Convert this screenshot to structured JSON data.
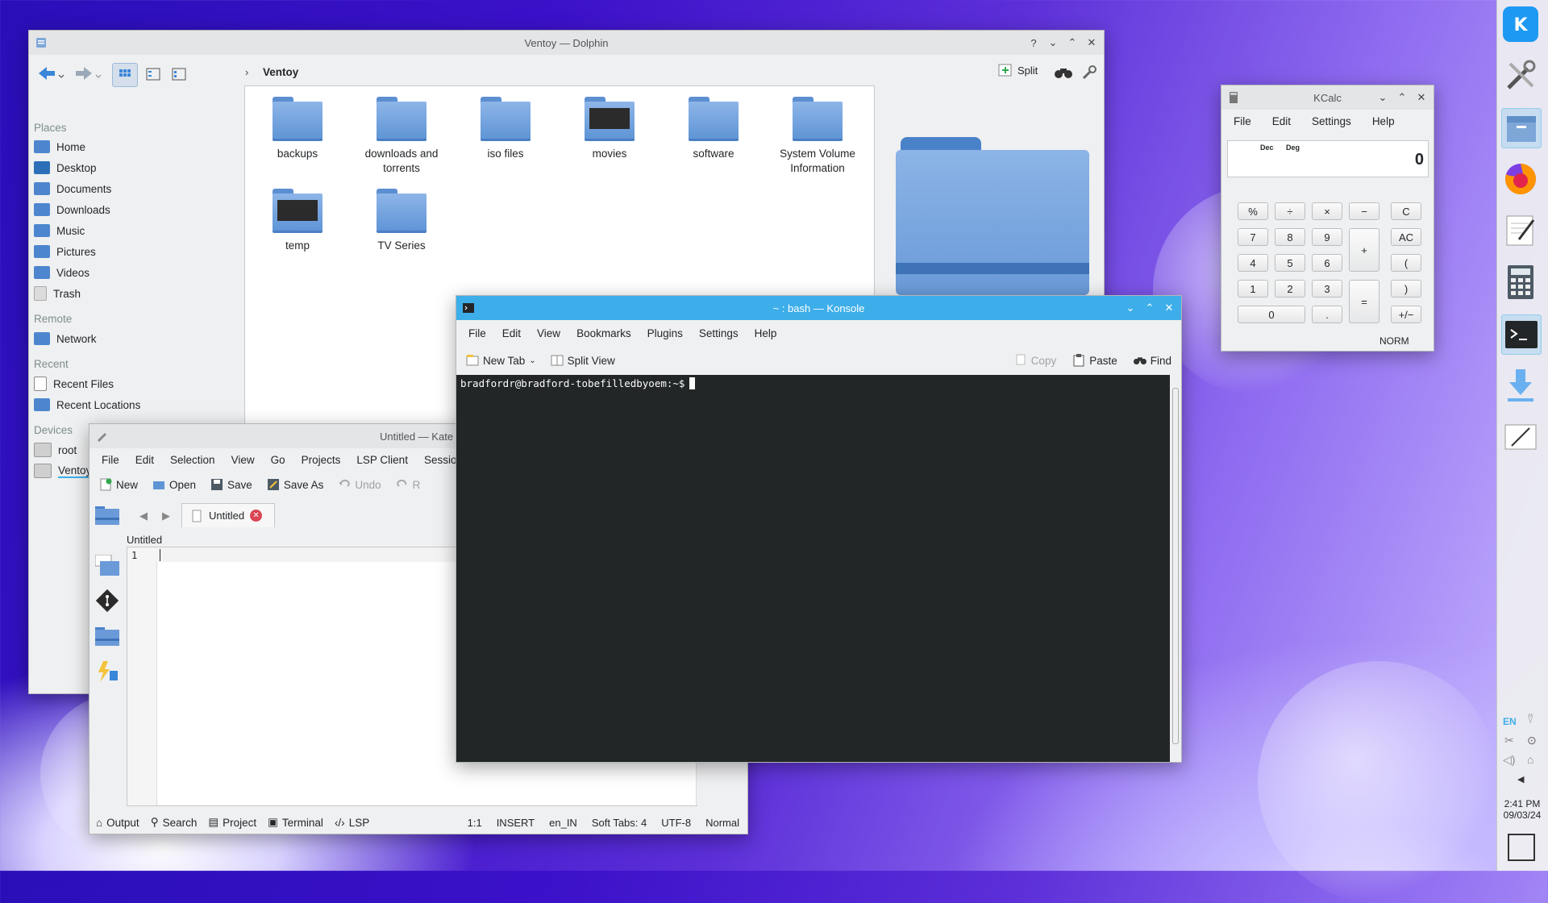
{
  "dolphin": {
    "title": "Ventoy — Dolphin",
    "breadcrumb": "Ventoy",
    "split_label": "Split",
    "places_header": "Places",
    "places": [
      "Home",
      "Desktop",
      "Documents",
      "Downloads",
      "Music",
      "Pictures",
      "Videos",
      "Trash"
    ],
    "remote_header": "Remote",
    "remote": [
      "Network"
    ],
    "recent_header": "Recent",
    "recent": [
      "Recent Files",
      "Recent Locations"
    ],
    "devices_header": "Devices",
    "devices": [
      "root",
      "Ventoy"
    ],
    "folders": [
      {
        "name": "backups",
        "icon": "folder-icon"
      },
      {
        "name": "downloads and",
        "name2": "torrents",
        "icon": "folder-icon"
      },
      {
        "name": "iso files",
        "icon": "folder-icon"
      },
      {
        "name": "movies",
        "icon": "folder-video-icon"
      },
      {
        "name": "software",
        "icon": "folder-icon"
      },
      {
        "name": "System Volume",
        "name2": "Information",
        "icon": "folder-icon"
      },
      {
        "name": "temp",
        "icon": "folder-video-icon"
      },
      {
        "name": "TV Series",
        "icon": "folder-icon"
      }
    ]
  },
  "kate": {
    "title": "Untitled — Kate",
    "menu": [
      "File",
      "Edit",
      "Selection",
      "View",
      "Go",
      "Projects",
      "LSP Client",
      "Session"
    ],
    "toolbar": {
      "new": "New",
      "open": "Open",
      "save": "Save",
      "save_as": "Save As",
      "undo": "Undo",
      "redo": "R"
    },
    "tab": "Untitled",
    "doc_title": "Untitled",
    "line_number": "1",
    "bottom": {
      "output": "Output",
      "search": "Search",
      "project": "Project",
      "terminal": "Terminal",
      "lsp": "LSP"
    },
    "status": {
      "position": "1:1",
      "mode": "INSERT",
      "lang": "en_IN",
      "tabs": "Soft Tabs: 4",
      "encoding": "UTF-8",
      "input": "Normal"
    }
  },
  "konsole": {
    "title": "~ : bash — Konsole",
    "menu": [
      "File",
      "Edit",
      "View",
      "Bookmarks",
      "Plugins",
      "Settings",
      "Help"
    ],
    "toolbar": {
      "new_tab": "New Tab",
      "split_view": "Split View",
      "copy": "Copy",
      "paste": "Paste",
      "find": "Find"
    },
    "prompt": "bradfordr@bradford-tobefilledbyoem:~$"
  },
  "kcalc": {
    "title": "KCalc",
    "menu": [
      "File",
      "Edit",
      "Settings",
      "Help"
    ],
    "dec": "Dec",
    "deg": "Deg",
    "display": "0",
    "keys": {
      "percent": "%",
      "divide": "÷",
      "multiply": "×",
      "minus": "−",
      "clear": "C",
      "k7": "7",
      "k8": "8",
      "k9": "9",
      "plus": "+",
      "allclear": "AC",
      "k4": "4",
      "k5": "5",
      "k6": "6",
      "lparen": "(",
      "k1": "1",
      "k2": "2",
      "k3": "3",
      "equals": "=",
      "rparen": ")",
      "k0": "0",
      "dot": ".",
      "plusminus": "+/−"
    },
    "mode": "NORM"
  },
  "panel": {
    "lang": "EN",
    "time": "2:41 PM",
    "date": "09/03/24"
  }
}
